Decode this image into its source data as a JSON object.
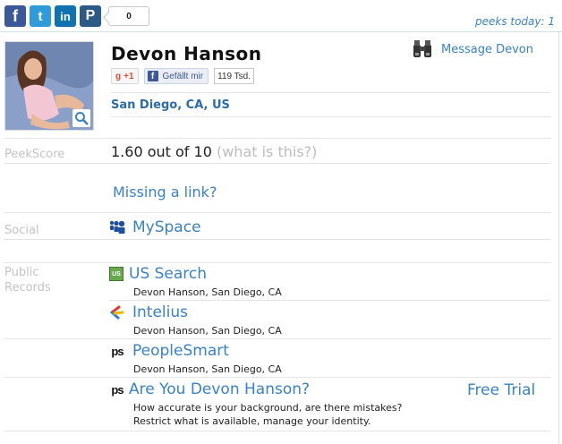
{
  "share_bar": {
    "icons": [
      "facebook-icon",
      "twitter-icon",
      "linkedin-icon",
      "pinterest-icon"
    ],
    "glyphs": {
      "facebook": "f",
      "twitter": "t",
      "linkedin": "in",
      "pinterest": "P"
    },
    "count": "0"
  },
  "peeks_today": "peeks today: 1",
  "profile": {
    "name": "Devon Hanson",
    "location": "San Diego, CA, US",
    "message_label": "Message Devon"
  },
  "social_buttons": {
    "gplus_label": "+1",
    "gplus_g": "g",
    "fb_like_label": "Gefällt mir",
    "fb_f": "f",
    "fb_count": "119 Tsd."
  },
  "peekscore": {
    "label": "PeekScore",
    "value": "1.60 out of 10",
    "what_link": "(what is this?)"
  },
  "missing_link": "Missing a link?",
  "social": {
    "label": "Social",
    "items": [
      {
        "name": "MySpace",
        "icon": "myspace-icon"
      }
    ]
  },
  "public_records": {
    "label_line1": "Public",
    "label_line2": "Records",
    "items": [
      {
        "name": "US Search",
        "detail": "Devon Hanson, San Diego, CA",
        "icon": "ussearch-icon",
        "icon_text": "US"
      },
      {
        "name": "Intelius",
        "detail": "Devon Hanson, San Diego, CA",
        "icon": "intelius-icon"
      },
      {
        "name": "PeopleSmart",
        "detail": "Devon Hanson, San Diego, CA",
        "icon": "peoplesmart-icon",
        "icon_text": "ps"
      }
    ],
    "promo": {
      "title": "Are You Devon Hanson?",
      "line1": "How accurate is your background, are there mistakes?",
      "line2": "Restrict what is available, manage your identity.",
      "free_trial": "Free Trial",
      "icon_text": "ps"
    }
  },
  "colors": {
    "link": "#3a82c4",
    "label": "#c4c4c4",
    "facebook": "#3b5998",
    "twitter": "#2f9bd8",
    "linkedin": "#1073b0",
    "pinterest": "#2b5a86"
  }
}
